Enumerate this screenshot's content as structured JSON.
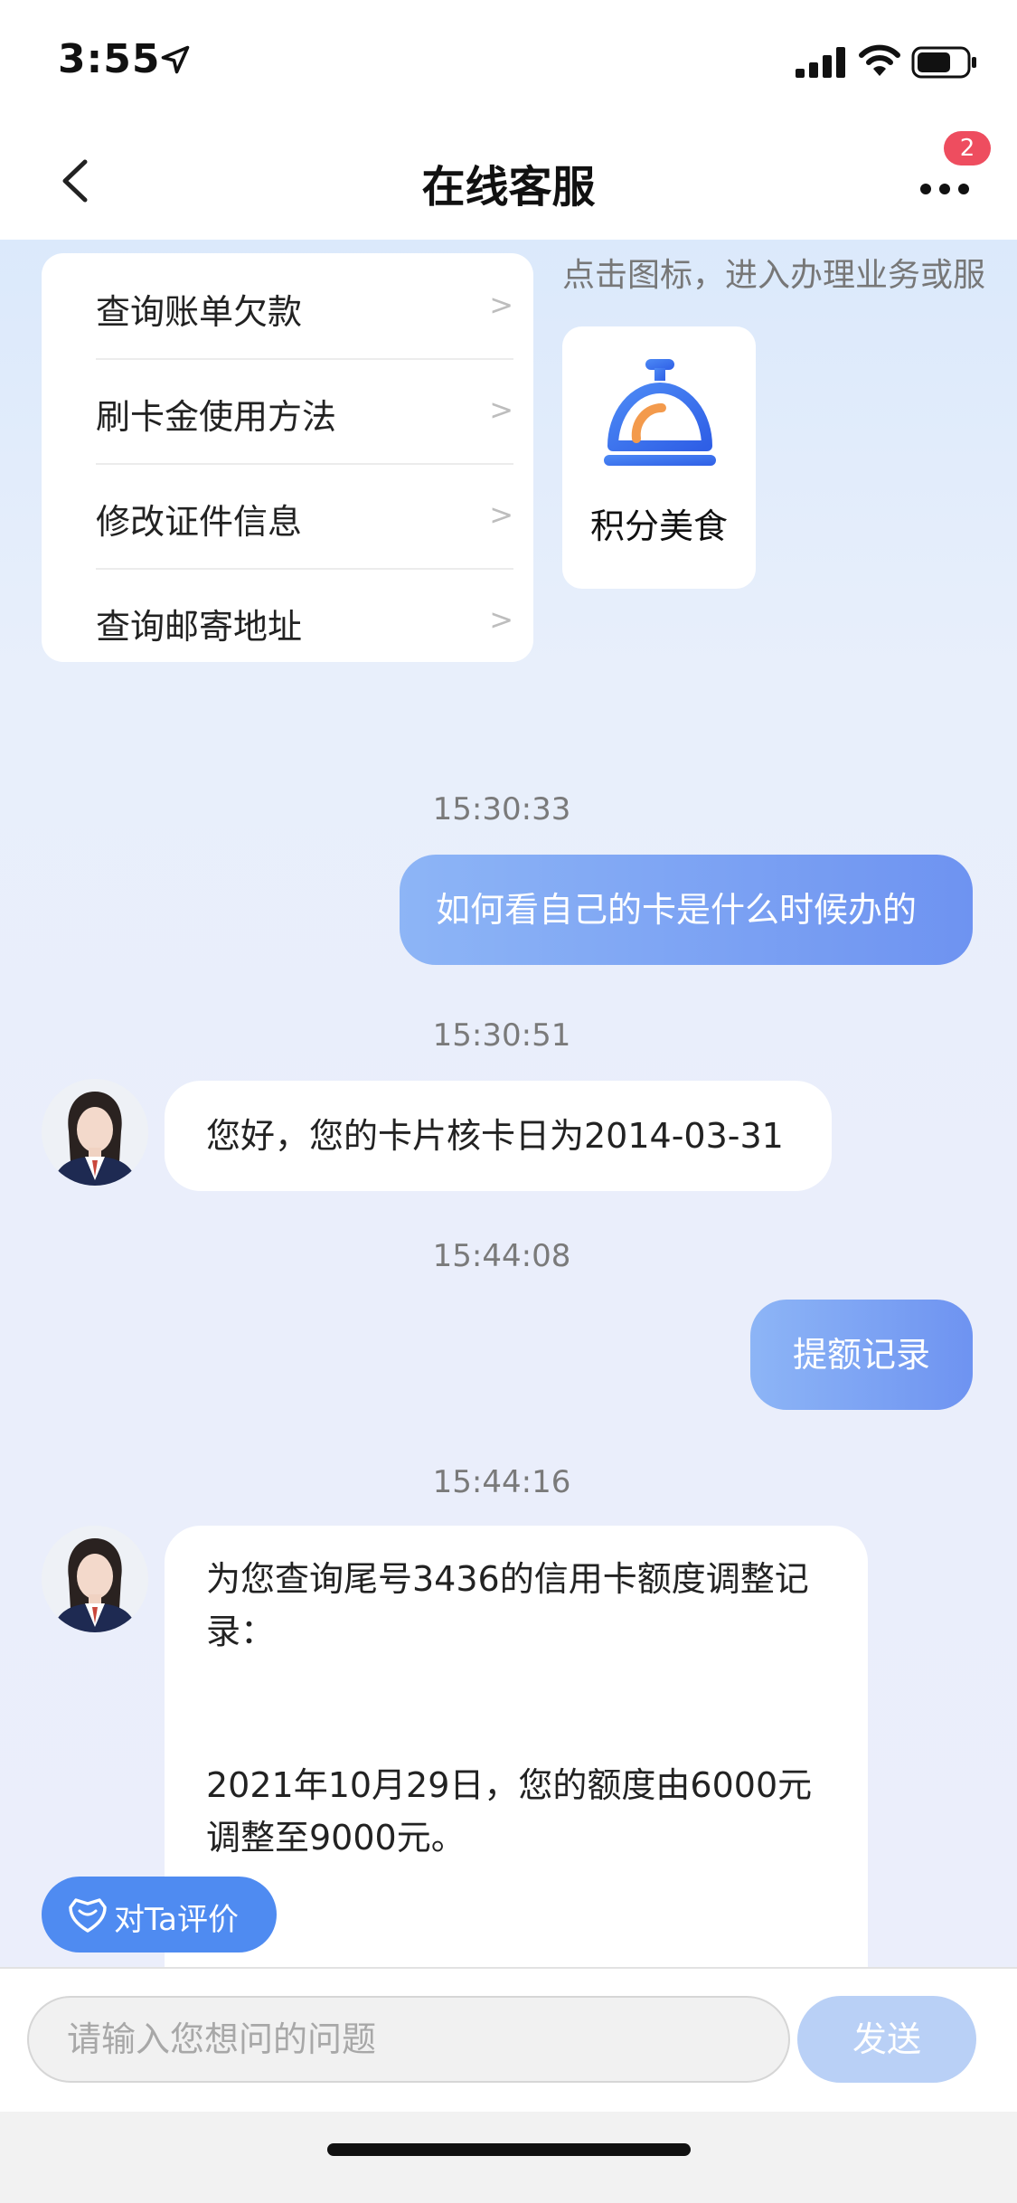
{
  "status_bar": {
    "time": "3:55"
  },
  "nav": {
    "title": "在线客服",
    "badge_count": "2"
  },
  "faq": {
    "items": [
      {
        "label": "查询账单欠款",
        "arrow": ">"
      },
      {
        "label": "刷卡金使用方法",
        "arrow": ">"
      },
      {
        "label": "修改证件信息",
        "arrow": ">"
      },
      {
        "label": "查询邮寄地址",
        "arrow": ">"
      }
    ]
  },
  "service": {
    "hint": "点击图标，进入办理业务或服",
    "card_label": "积分美食"
  },
  "messages": [
    {
      "time": "15:30:33",
      "from": "user",
      "text": "如何看自己的卡是什么时候办的"
    },
    {
      "time": "15:30:51",
      "from": "agent",
      "text": "您好，您的卡片核卡日为2014-03-31"
    },
    {
      "time": "15:44:08",
      "from": "user",
      "text": "提额记录"
    },
    {
      "time": "15:44:16",
      "from": "agent",
      "text_line1": "为您查询尾号3436的信用卡额度调整记",
      "text_line2": "录：",
      "text_line3": "2021年10月29日，您的额度由6000元",
      "text_line4": "调整至9000元。"
    }
  ],
  "rate_button": {
    "label": "对Ta评价"
  },
  "input": {
    "placeholder": "请输入您想问的问题",
    "send_label": "发送"
  },
  "colors": {
    "accent": "#6e93f1",
    "badge": "#ee4d5f",
    "rate_button": "#4f8bf1"
  }
}
